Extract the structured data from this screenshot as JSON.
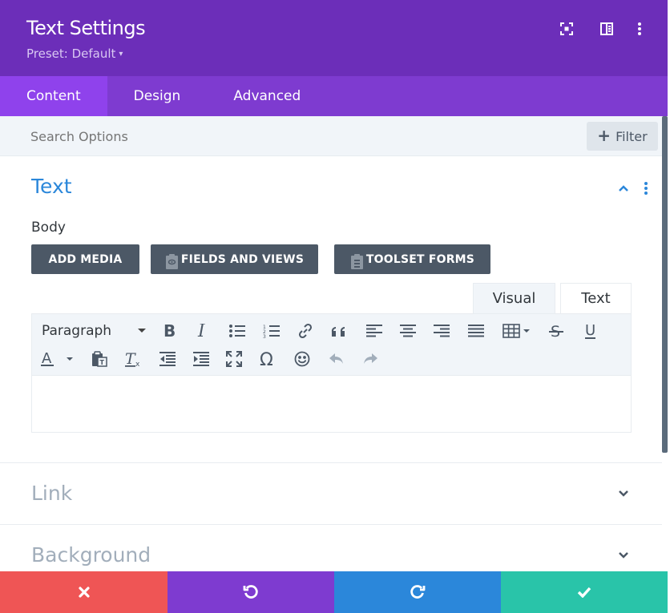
{
  "header": {
    "title": "Text Settings",
    "preset": "Preset: Default",
    "icons": [
      "fullscreen-icon",
      "split-view-icon",
      "more-vertical-icon"
    ],
    "background": "#6c2eb9"
  },
  "tabs": [
    {
      "label": "Content",
      "active": true
    },
    {
      "label": "Design",
      "active": false
    },
    {
      "label": "Advanced",
      "active": false
    }
  ],
  "search": {
    "placeholder": "Search Options",
    "filter_label": "Filter"
  },
  "text_section": {
    "title": "Text",
    "body_label": "Body",
    "buttons": {
      "add_media": "ADD MEDIA",
      "fields_and_views": "FIELDS AND VIEWS",
      "toolset_forms": "TOOLSET FORMS"
    },
    "editor_tabs": {
      "visual": "Visual",
      "text": "Text"
    },
    "toolbar": {
      "format_select": "Paragraph",
      "row1_icons": [
        "bold-icon",
        "italic-icon",
        "bullet-list-icon",
        "numbered-list-icon",
        "link-icon",
        "blockquote-icon",
        "align-left-icon",
        "align-center-icon",
        "align-right-icon",
        "justify-icon",
        "table-icon",
        "strikethrough-icon",
        "underline-icon"
      ],
      "row2_icons": [
        "text-color-icon",
        "paste-text-icon",
        "clear-formatting-icon",
        "outdent-icon",
        "indent-icon",
        "fullscreen-icon",
        "omega-icon",
        "emoji-icon",
        "undo-icon",
        "redo-icon"
      ]
    }
  },
  "collapsed_sections": [
    {
      "title": "Link"
    },
    {
      "title": "Background"
    }
  ],
  "footer": {
    "buttons": [
      "cancel-icon",
      "undo-icon",
      "redo-icon",
      "save-icon"
    ],
    "colors": {
      "cancel": "#ef5555",
      "undo": "#7e3bd0",
      "redo": "#2b87da",
      "save": "#29c4a9"
    }
  },
  "colors": {
    "accent": "#2b87da",
    "tab_bar": "#7e3bd0",
    "active_tab": "#8f42ec",
    "dark_button": "#4c5866"
  }
}
